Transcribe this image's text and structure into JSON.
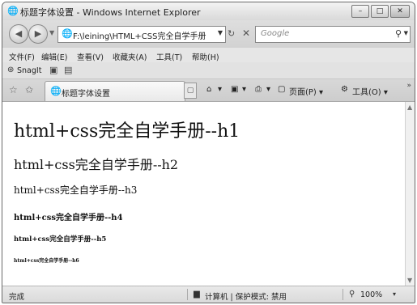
{
  "window": {
    "title": "标题字体设置 - Windows Internet Explorer",
    "buttons": [
      "–",
      "□",
      "✕"
    ]
  },
  "address": {
    "url": "F:\\leining\\HTML+CSS完全自学手册",
    "search_placeholder": "Google"
  },
  "menu": {
    "items": [
      "文件(F)",
      "编辑(E)",
      "查看(V)",
      "收藏夹(A)",
      "工具(T)",
      "帮助(H)"
    ]
  },
  "snagit": {
    "label": "SnagIt"
  },
  "tab": {
    "title": "标题字体设置"
  },
  "commands": {
    "page": "页面(P) ▾",
    "tools": "工具(O) ▾"
  },
  "content": {
    "h1": "html+css完全自学手册--h1",
    "h2": "html+css完全自学手册--h2",
    "h3": "html+css完全自学手册--h3",
    "h4": "html+css完全自学手册--h4",
    "h5": "html+css完全自学手册--h5",
    "h6": "html+css完全自学手册--h6"
  },
  "status": {
    "text": "完成",
    "zone": "计算机 | 保护模式: 禁用",
    "zoom": "100%"
  },
  "icons": {
    "ie": "🌐",
    "back": "◀",
    "forward": "▶",
    "refresh": "↻",
    "stop": "✕",
    "search": "⚲",
    "star": "☆",
    "home": "⌂",
    "feed": "▣",
    "print": "⎙"
  }
}
